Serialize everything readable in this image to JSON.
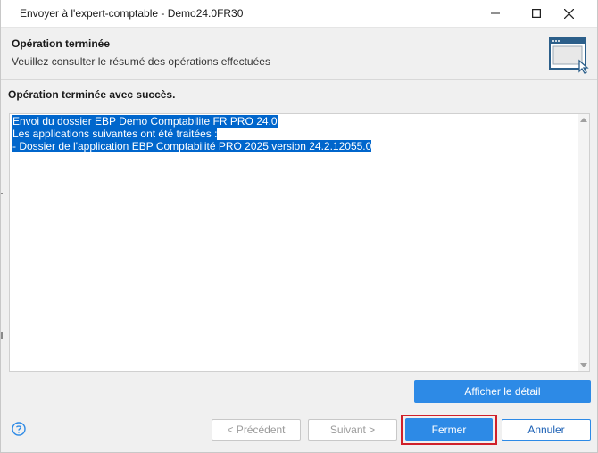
{
  "window": {
    "title": "Envoyer à l'expert-comptable - Demo24.0FR30"
  },
  "header": {
    "title": "Opération terminée",
    "subtitle": "Veuillez consulter le résumé des opérations effectuées"
  },
  "main": {
    "status_title": "Opération terminée avec succès.",
    "log_lines": [
      "Envoi du dossier EBP Demo Comptabilite FR PRO 24.0",
      "Les applications suivantes ont été traitées :",
      "- Dossier de l'application EBP Comptabilité PRO 2025 version 24.2.12055.0"
    ],
    "detail_button": "Afficher le détail"
  },
  "footer": {
    "prev_label": "< Précédent",
    "next_label": "Suivant >",
    "close_label": "Fermer",
    "cancel_label": "Annuler"
  },
  "colors": {
    "accent": "#2d8ae6",
    "highlight": "#d0202a",
    "selection": "#0066cc"
  },
  "icons": {
    "help": "help-circle-icon",
    "header": "window-cursor-icon",
    "minimize": "minimize-icon",
    "maximize": "maximize-icon",
    "close": "close-icon"
  }
}
